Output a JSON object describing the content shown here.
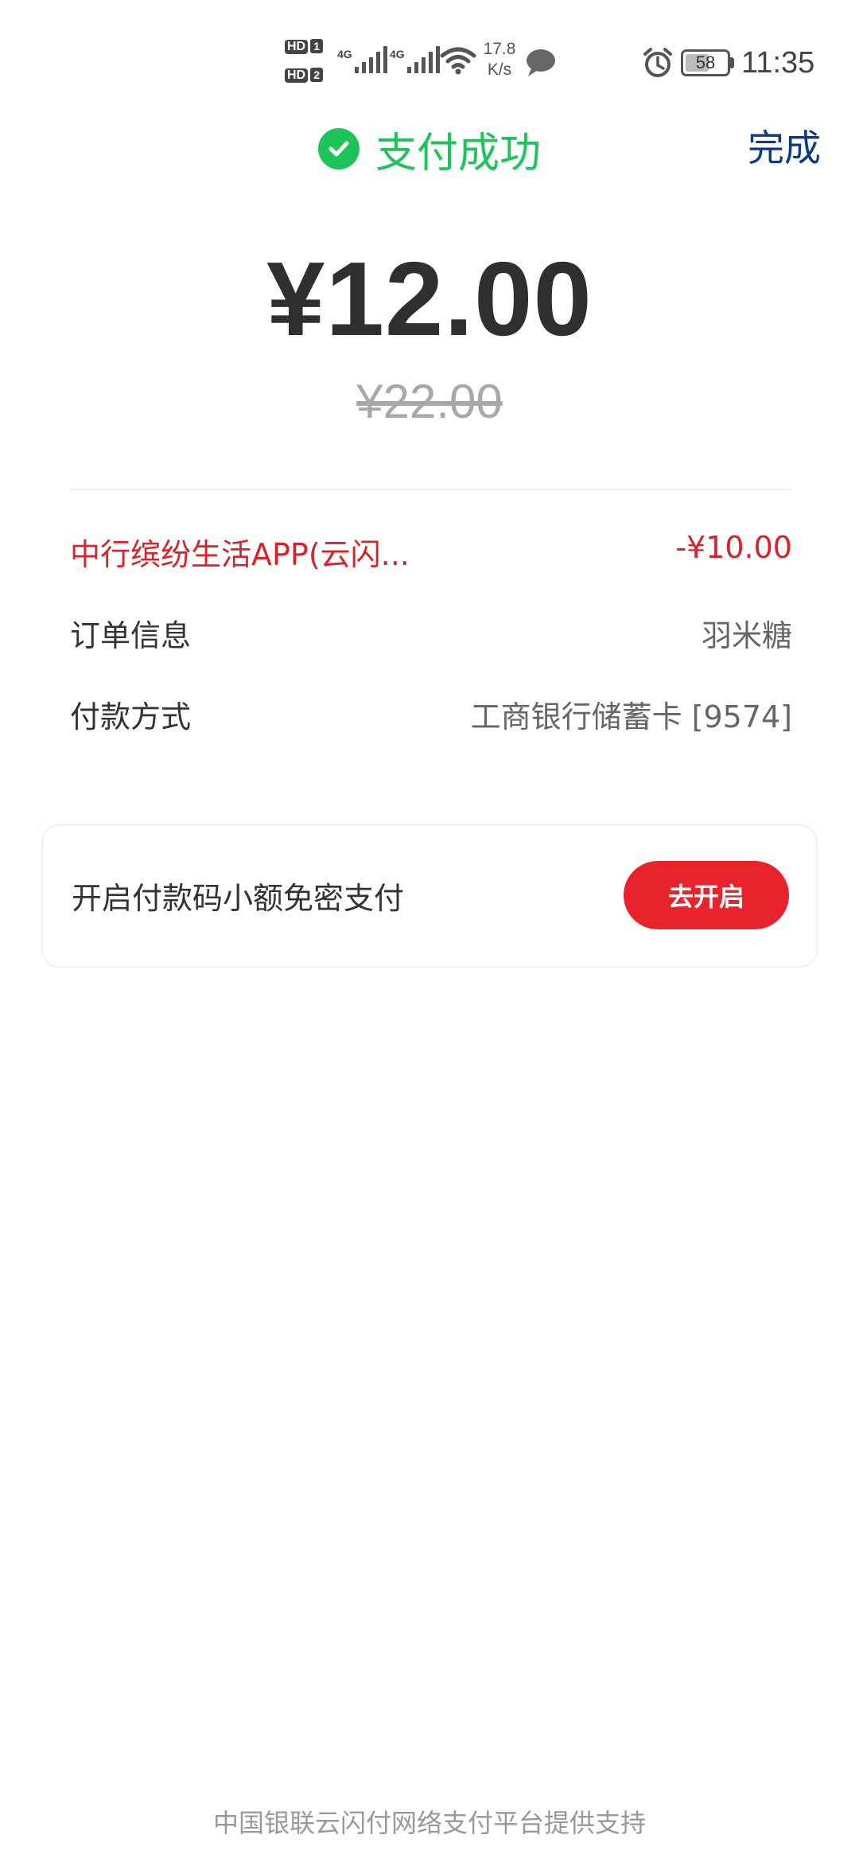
{
  "status_bar": {
    "sim1_badge": "HD",
    "sim1_num": "1",
    "sim2_badge": "HD",
    "sim2_num": "2",
    "net1": "4G",
    "net2": "4G",
    "speed_value": "17.8",
    "speed_unit": "K/s",
    "battery_percent": "58",
    "battery_level": 0.58,
    "time": "11:35",
    "icons": [
      "signal-icon",
      "wifi-icon",
      "message-icon",
      "alarm-icon",
      "battery-icon"
    ]
  },
  "header": {
    "title": "支付成功",
    "done_label": "完成",
    "success_color": "#1ec45a",
    "done_color": "#0d3a82"
  },
  "payment": {
    "amount": "¥12.00",
    "original_amount": "¥22.00"
  },
  "details": {
    "discount_label": "中行缤纷生活APP(云闪...",
    "discount_value": "-¥10.00",
    "order_label": "订单信息",
    "order_value": "羽米糖",
    "method_label": "付款方式",
    "method_value": "工商银行储蓄卡 [9574]"
  },
  "promo": {
    "text": "开启付款码小额免密支付",
    "button_label": "去开启",
    "button_color": "#e8232c"
  },
  "footer": {
    "text": "中国银联云闪付网络支付平台提供支持"
  }
}
